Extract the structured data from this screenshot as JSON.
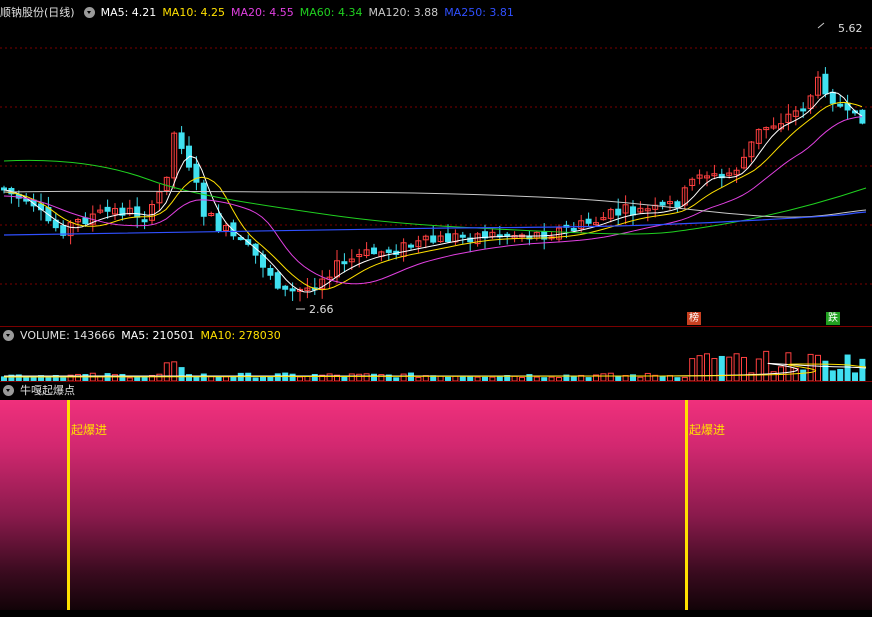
{
  "main_panel": {
    "stock_name": "顺钠股份(日线)",
    "ma_legend": [
      {
        "label": "MA5: 4.21",
        "color": "#ffffff"
      },
      {
        "label": "MA10: 4.25",
        "color": "#ffe000"
      },
      {
        "label": "MA20: 4.55",
        "color": "#e040e0"
      },
      {
        "label": "MA60: 4.34",
        "color": "#20d020"
      },
      {
        "label": "MA120: 3.88",
        "color": "#c8c8c8"
      },
      {
        "label": "MA250: 3.81",
        "color": "#3050ff"
      }
    ],
    "high_label": "5.62",
    "low_label": "2.66",
    "badges": [
      {
        "text": "榜",
        "color": "#c84020"
      },
      {
        "text": "跌",
        "color": "#20a020"
      }
    ]
  },
  "volume_panel": {
    "title": "VOLUME: 143666",
    "ma5": "MA5: 210501",
    "ma10": "MA10: 278030",
    "ma5_color": "#ffffff",
    "ma10_color": "#ffe000"
  },
  "indicator_panel": {
    "title": "牛嘎起爆点",
    "signal_label": "起爆进",
    "signal_color": "#ffe000"
  },
  "colors": {
    "up": "#ff4040",
    "down": "#40e0f0",
    "grid": "#7a0000"
  }
}
